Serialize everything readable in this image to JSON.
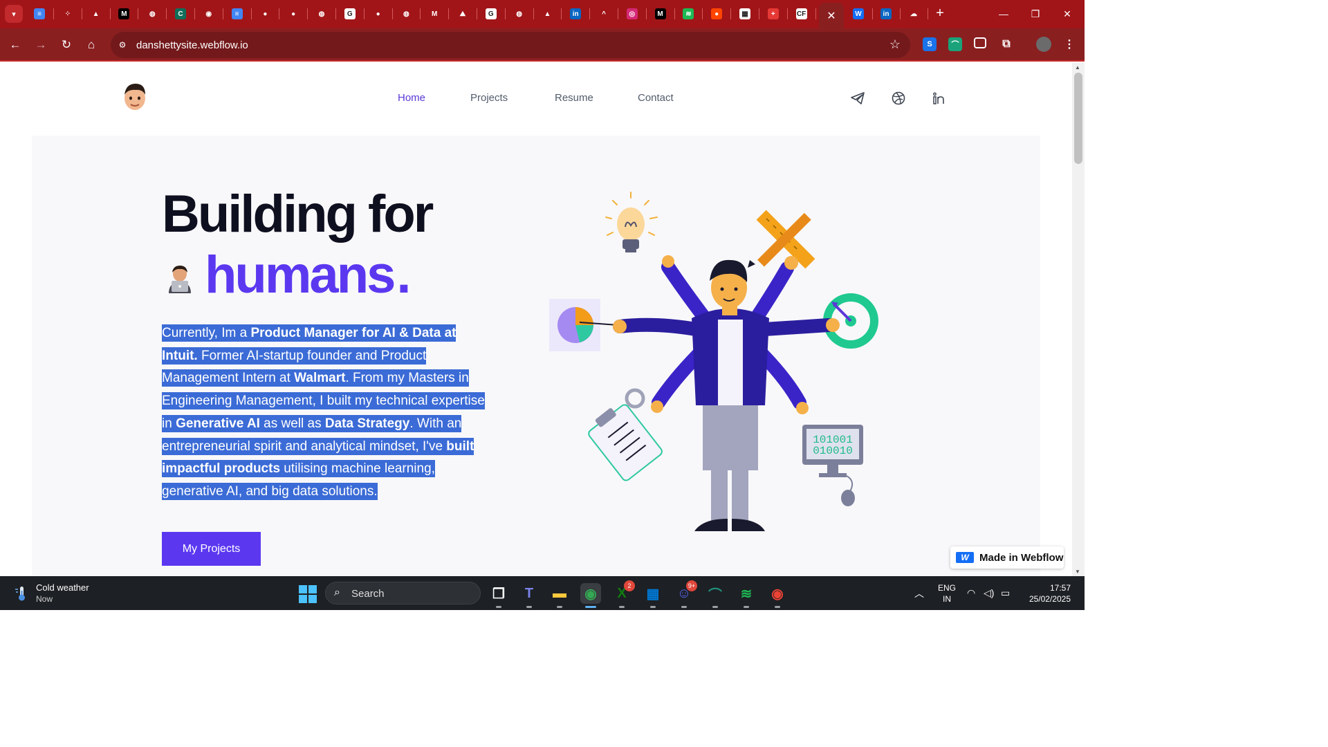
{
  "browser": {
    "url": "danshettysite.webflow.io",
    "tabs": [
      {
        "icon": "google-docs-icon",
        "color": "#4285f4",
        "glyph": "≡"
      },
      {
        "icon": "dots-app-icon",
        "color": "#a11518",
        "glyph": "⁘"
      },
      {
        "icon": "incognito-hat-icon",
        "color": "#a11518",
        "glyph": "▲"
      },
      {
        "icon": "medium-icon",
        "color": "#000000",
        "glyph": "M"
      },
      {
        "icon": "globe-icon",
        "color": "#a11518",
        "glyph": "◍"
      },
      {
        "icon": "c-app-icon",
        "color": "#0f6e5a",
        "glyph": "C"
      },
      {
        "icon": "chrome-icon",
        "color": "#a11518",
        "glyph": "◉"
      },
      {
        "icon": "google-docs-icon",
        "color": "#4285f4",
        "glyph": "≡"
      },
      {
        "icon": "github-icon",
        "color": "#a11518",
        "glyph": "●"
      },
      {
        "icon": "github-icon",
        "color": "#a11518",
        "glyph": "●"
      },
      {
        "icon": "globe-icon",
        "color": "#a11518",
        "glyph": "◍"
      },
      {
        "icon": "google-icon",
        "color": "#ffffff",
        "glyph": "G"
      },
      {
        "icon": "github-icon",
        "color": "#a11518",
        "glyph": "●"
      },
      {
        "icon": "globe-icon",
        "color": "#a11518",
        "glyph": "◍"
      },
      {
        "icon": "gmail-icon",
        "color": "#a11518",
        "glyph": "M"
      },
      {
        "icon": "mountain-icon",
        "color": "#a11518",
        "glyph": "⛰"
      },
      {
        "icon": "google-icon",
        "color": "#ffffff",
        "glyph": "G"
      },
      {
        "icon": "globe-icon",
        "color": "#a11518",
        "glyph": "◍"
      },
      {
        "icon": "google-drive-icon",
        "color": "#a11518",
        "glyph": "▲"
      },
      {
        "icon": "linkedin-icon",
        "color": "#0a66c2",
        "glyph": "in"
      },
      {
        "icon": "arc-icon",
        "color": "#a11518",
        "glyph": "^"
      },
      {
        "icon": "instagram-icon",
        "color": "#d62976",
        "glyph": "◎"
      },
      {
        "icon": "medium-icon",
        "color": "#000000",
        "glyph": "M"
      },
      {
        "icon": "spotify-icon",
        "color": "#1db954",
        "glyph": "≋"
      },
      {
        "icon": "reddit-icon",
        "color": "#ff4500",
        "glyph": "●"
      },
      {
        "icon": "grid-icon",
        "color": "#ffffff",
        "glyph": "▦"
      },
      {
        "icon": "plus-red-icon",
        "color": "#e53935",
        "glyph": "+"
      },
      {
        "icon": "codeforces-icon",
        "color": "#ffffff",
        "glyph": "CF"
      }
    ],
    "tabs_after": [
      {
        "icon": "webflow-icon",
        "color": "#146ef5",
        "glyph": "W"
      },
      {
        "icon": "linkedin-icon",
        "color": "#0a66c2",
        "glyph": "in"
      },
      {
        "icon": "cloud-icon",
        "color": "#a11518",
        "glyph": "☁"
      }
    ],
    "tab_close": "✕",
    "new_tab": "+",
    "window": {
      "minimize": "—",
      "restore": "❐",
      "close": "✕"
    }
  },
  "nav": {
    "links": [
      "Home",
      "Projects",
      "Resume",
      "Contact"
    ],
    "social": [
      "telegram-icon",
      "dribbble-icon",
      "linkedin-icon"
    ]
  },
  "hero": {
    "line1": "Building for",
    "line2_word": "humans",
    "line2_dot": ".",
    "paragraph": [
      {
        "t": "Currently, Im a ",
        "b": false
      },
      {
        "t": "Product Manager for AI & Data at Intuit.",
        "b": true
      },
      {
        "t": " Former AI-startup founder and Product Management Intern at ",
        "b": false
      },
      {
        "t": "Walmart",
        "b": true
      },
      {
        "t": ". From my Masters in Engineering Management, I built my technical expertise in ",
        "b": false
      },
      {
        "t": "Generative AI",
        "b": true
      },
      {
        "t": " as well as ",
        "b": false
      },
      {
        "t": "Data Strategy",
        "b": true
      },
      {
        "t": ". With an entrepreneurial spirit and analytical mindset, I've ",
        "b": false
      },
      {
        "t": "built impactful products",
        "b": true
      },
      {
        "t": " utilising machine learning, generative AI, and big data solutions.",
        "b": false
      }
    ],
    "cta": "My Projects",
    "binary_1": "101001",
    "binary_2": "010010"
  },
  "badge": {
    "label": "Made in Webflow"
  },
  "taskbar": {
    "weather_title": "Cold weather",
    "weather_sub": "Now",
    "search": "Search",
    "apps": [
      {
        "name": "task-view-icon",
        "glyph": "❐",
        "color": "#ffffff"
      },
      {
        "name": "teams-icon",
        "glyph": "T",
        "color": "#7b83eb"
      },
      {
        "name": "file-explorer-icon",
        "glyph": "▬",
        "color": "#ffc83d"
      },
      {
        "name": "chrome-icon",
        "glyph": "◉",
        "color": "#34a853",
        "active": true
      },
      {
        "name": "xbox-icon",
        "glyph": "X",
        "color": "#107c10",
        "badge": "2"
      },
      {
        "name": "store-icon",
        "glyph": "▦",
        "color": "#0078d4"
      },
      {
        "name": "discord-icon",
        "glyph": "☺",
        "color": "#5865f2",
        "badge": "9+"
      },
      {
        "name": "arc-browser-icon",
        "glyph": "⌒",
        "color": "#1f8f7a"
      },
      {
        "name": "spotify-icon",
        "glyph": "≋",
        "color": "#1db954"
      },
      {
        "name": "chrome-profile-icon",
        "glyph": "◉",
        "color": "#ea4335"
      }
    ],
    "lang_1": "ENG",
    "lang_2": "IN",
    "time": "17:57",
    "date": "25/02/2025"
  }
}
